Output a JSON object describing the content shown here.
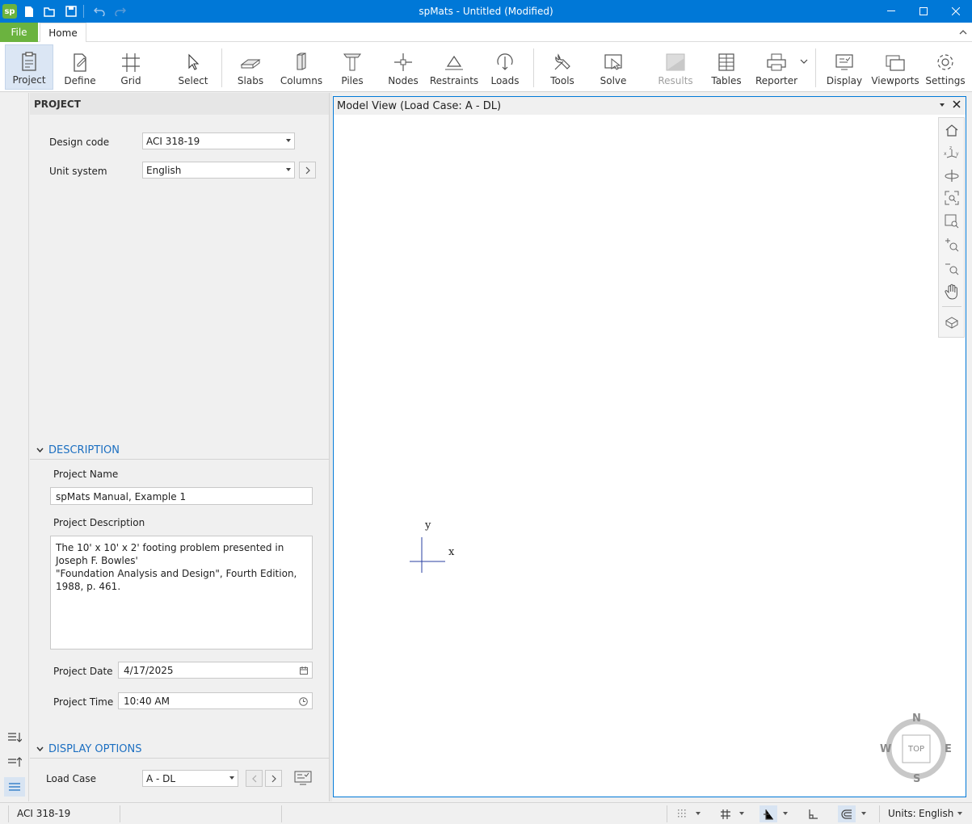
{
  "window": {
    "title": "spMats - Untitled (Modified)",
    "app_icon_text": "sp"
  },
  "ribbon_tabs": {
    "file": "File",
    "home": "Home"
  },
  "ribbon": {
    "project": "Project",
    "define": "Define",
    "grid": "Grid",
    "select": "Select",
    "slabs": "Slabs",
    "columns": "Columns",
    "piles": "Piles",
    "nodes": "Nodes",
    "restraints": "Restraints",
    "loads": "Loads",
    "tools": "Tools",
    "solve": "Solve",
    "results": "Results",
    "tables": "Tables",
    "reporter": "Reporter",
    "display": "Display",
    "viewports": "Viewports",
    "settings": "Settings"
  },
  "panel": {
    "header": "PROJECT",
    "design_code_label": "Design code",
    "design_code_value": "ACI 318-19",
    "unit_system_label": "Unit system",
    "unit_system_value": "English",
    "description_title": "DESCRIPTION",
    "project_name_label": "Project Name",
    "project_name_value": "spMats Manual, Example 1",
    "project_description_label": "Project Description",
    "project_description_value": "The 10' x 10' x 2' footing problem presented in Joseph F. Bowles'\n\"Foundation Analysis and Design\", Fourth Edition, 1988, p. 461.",
    "project_date_label": "Project Date",
    "project_date_value": "4/17/2025",
    "project_time_label": "Project Time",
    "project_time_value": "10:40 AM",
    "display_options_title": "DISPLAY OPTIONS",
    "load_case_label": "Load Case",
    "load_case_value": "A - DL"
  },
  "model_view": {
    "title": "Model View (Load Case: A - DL)",
    "axis_x": "x",
    "axis_y": "y",
    "compass": {
      "n": "N",
      "s": "S",
      "e": "E",
      "w": "W",
      "center": "TOP"
    }
  },
  "statusbar": {
    "code": "ACI 318-19",
    "units_label": "Units:",
    "units_value": "English"
  },
  "colors": {
    "title_bar": "#0078d7",
    "file_tab": "#6bb33f",
    "section_heading": "#1c6fc1",
    "active_button": "#dbe6f4"
  }
}
